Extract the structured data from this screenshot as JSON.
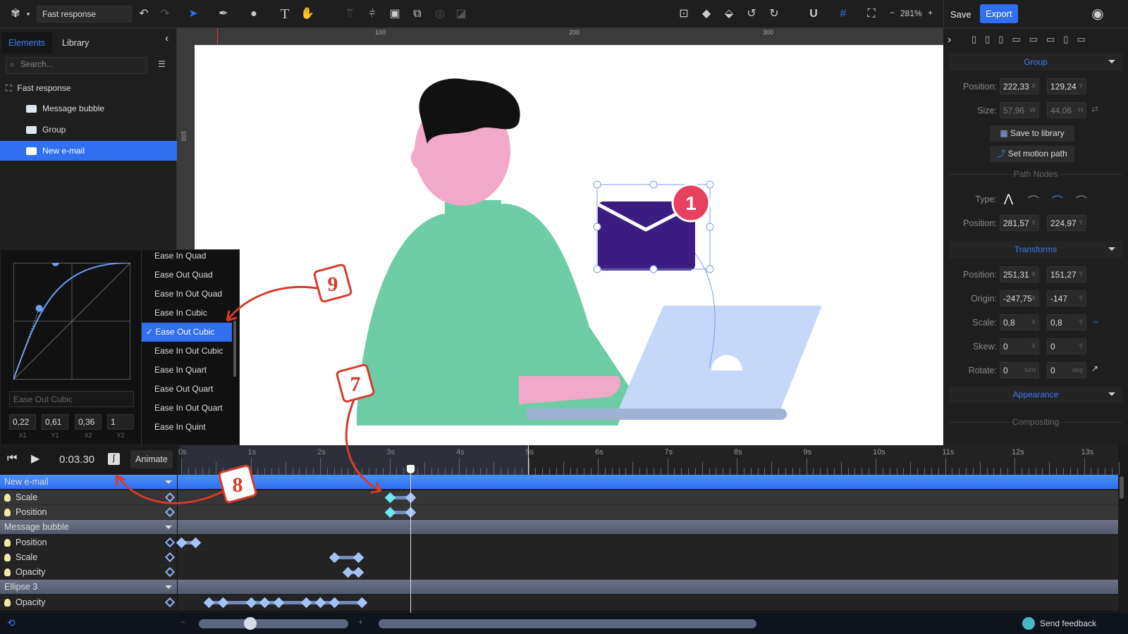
{
  "toolbar": {
    "doc_name": "Fast response",
    "save": "Save",
    "export": "Export",
    "zoom": "281%",
    "zoom_minus": "−",
    "zoom_plus": "+",
    "accent": "#2f6ff0"
  },
  "left_panel": {
    "tabs": [
      {
        "label": "Elements",
        "active": true
      },
      {
        "label": "Library",
        "active": false
      }
    ],
    "search_placeholder": "Search...",
    "tree": [
      {
        "label": "Fast response",
        "icon": "artboard-icon"
      },
      {
        "label": "Message bubble",
        "icon": "folder-icon"
      },
      {
        "label": "Group",
        "icon": "folder-icon"
      },
      {
        "label": "New e-mail",
        "icon": "folder-icon",
        "selected": true
      }
    ]
  },
  "rulers": {
    "top": [
      "100",
      "200",
      "300"
    ],
    "left": [
      "100"
    ]
  },
  "canvas": {
    "badge": "1"
  },
  "right_panel": {
    "group": {
      "title": "Group",
      "position_label": "Position:",
      "pos_x": "222,33",
      "pos_y": "129,24",
      "size_label": "Size:",
      "w": "57,96",
      "h": "44,06",
      "save_to_library": "Save to library",
      "set_motion_path": "Set motion path"
    },
    "path_nodes": {
      "title": "Path Nodes",
      "type_label": "Type:",
      "position_label": "Position:",
      "x": "281,57",
      "y": "224,97"
    },
    "transforms": {
      "title": "Transforms",
      "position_label": "Position:",
      "pos_x": "251,31",
      "pos_y": "151,27",
      "origin_label": "Origin:",
      "origin_x": "-247,75",
      "origin_y": "-147",
      "scale_label": "Scale:",
      "scale_x": "0,8",
      "scale_y": "0,8",
      "skew_label": "Skew:",
      "skew_x": "0",
      "skew_y": "0",
      "rotate_label": "Rotate:",
      "rotate_turn": "0",
      "rotate_deg": "0",
      "unit_x": "X",
      "unit_y": "Y",
      "unit_w": "W",
      "unit_h": "H",
      "unit_turn": "turn",
      "unit_deg": "deg"
    },
    "appearance": {
      "title": "Appearance"
    },
    "compositing": {
      "title": "Compositing"
    }
  },
  "easing": {
    "options": [
      "Ease In Quad",
      "Ease Out Quad",
      "Ease In Out Quad",
      "Ease In Cubic",
      "Ease Out Cubic",
      "Ease In Out Cubic",
      "Ease In Quart",
      "Ease Out Quart",
      "Ease In Out Quart",
      "Ease In Quint"
    ],
    "selected": "Ease Out Cubic",
    "name_field": "Ease Out Cubic",
    "x1": "0,22",
    "y1": "0,61",
    "x2": "0,36",
    "y2": "1",
    "labels": [
      "X1",
      "Y1",
      "X2",
      "Y2"
    ]
  },
  "timeline": {
    "time": "0:03.30",
    "playhead_s": 3.3,
    "animate": "Animate",
    "ticks": [
      "0s",
      "1s",
      "2s",
      "3s",
      "4s",
      "5s",
      "6s",
      "7s",
      "8s",
      "9s",
      "10s",
      "11s",
      "12s",
      "13s"
    ],
    "rows": [
      {
        "type": "group",
        "name": "New e-mail",
        "selected": true
      },
      {
        "type": "prop",
        "name": "Scale",
        "keys": [
          3.0,
          3.3
        ],
        "cyan_first": true
      },
      {
        "type": "prop",
        "name": "Position",
        "keys": [
          3.0,
          3.3
        ],
        "cyan_first": true
      },
      {
        "type": "group",
        "name": "Message bubble"
      },
      {
        "type": "prop",
        "name": "Position",
        "keys": [
          0.0,
          0.2
        ]
      },
      {
        "type": "prop",
        "name": "Scale",
        "keys": [
          2.2,
          2.55
        ]
      },
      {
        "type": "prop",
        "name": "Opacity",
        "keys": [
          2.4,
          2.55
        ]
      },
      {
        "type": "group",
        "name": "Ellipse 3"
      },
      {
        "type": "prop",
        "name": "Opacity",
        "keys": [
          0.4,
          0.6,
          1.0,
          1.2,
          1.4,
          1.8,
          2.0,
          2.2,
          2.6
        ]
      }
    ]
  },
  "annotations": [
    "7",
    "8",
    "9"
  ],
  "footer": {
    "send_feedback": "Send feedback",
    "zoom_minus": "−",
    "zoom_plus": "+"
  }
}
